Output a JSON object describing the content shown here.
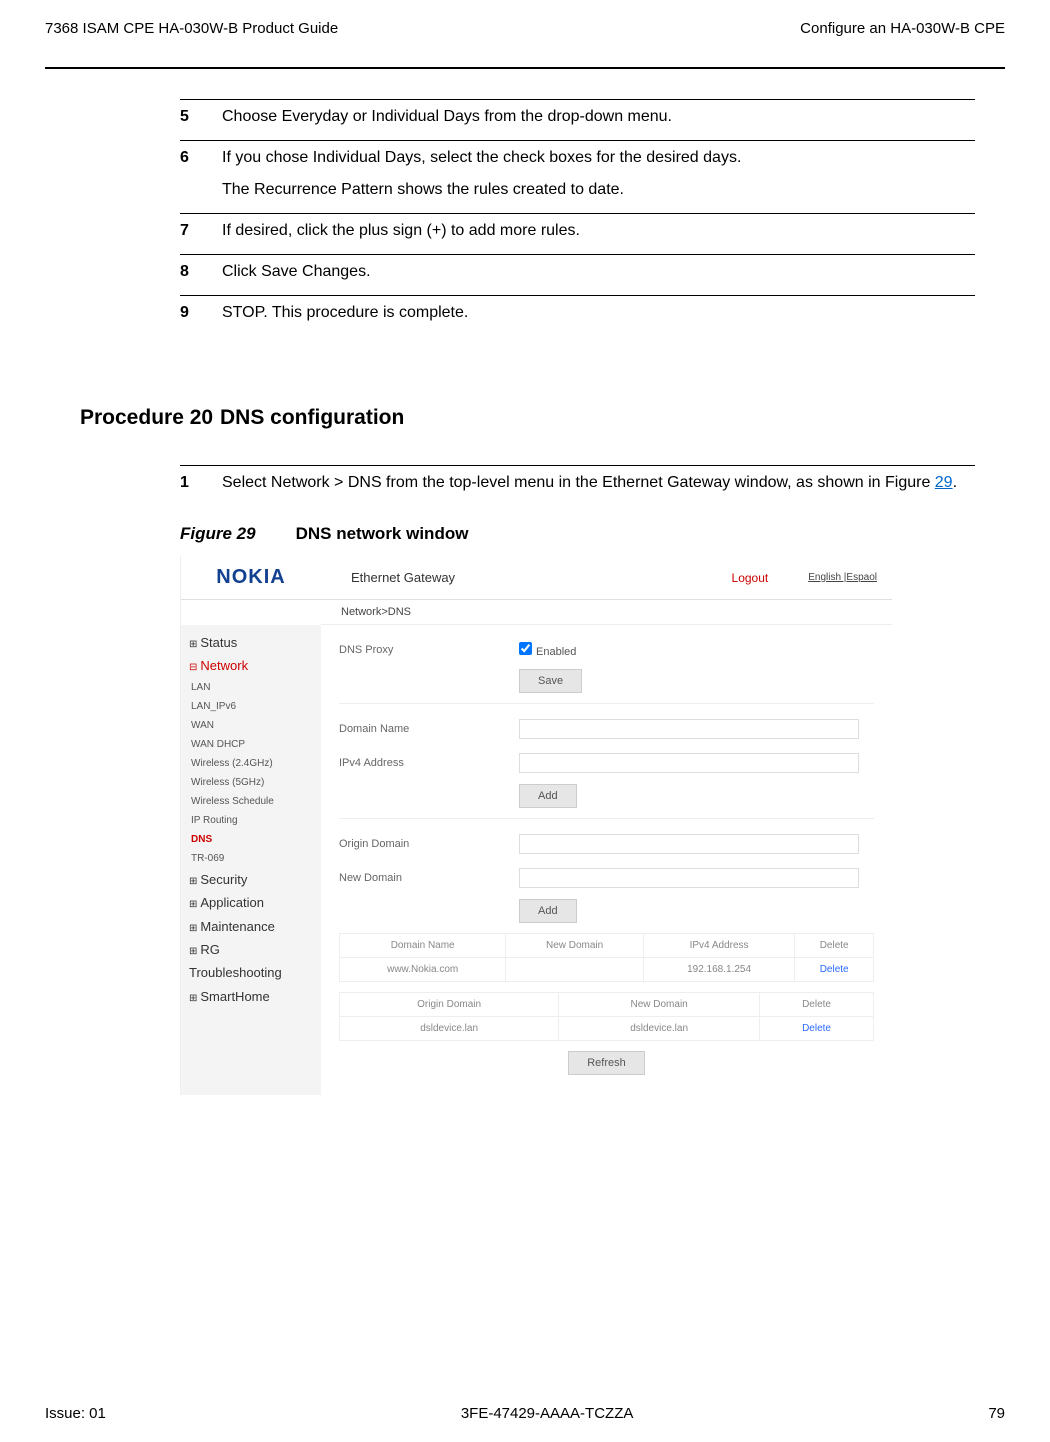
{
  "header": {
    "left": "7368 ISAM CPE HA-030W-B Product Guide",
    "right": "Configure an HA-030W-B CPE"
  },
  "steps_a": [
    {
      "n": "5",
      "t": "Choose Everyday or Individual Days from the drop-down menu."
    },
    {
      "n": "6",
      "t": "If you chose Individual Days, select the check boxes for the desired days.",
      "sub": "The Recurrence Pattern shows the rules created to date."
    },
    {
      "n": "7",
      "t": "If desired, click the plus sign (+) to add more rules."
    },
    {
      "n": "8",
      "t": "Click Save Changes."
    },
    {
      "n": "9",
      "t": "STOP. This procedure is complete."
    }
  ],
  "procedure": {
    "label": "Procedure 20",
    "title": "DNS configuration"
  },
  "step_b": {
    "n": "1",
    "pre": "Select Network > DNS from the top-level menu in the Ethernet Gateway window, as shown in Figure ",
    "link": "29",
    "post": "."
  },
  "figure": {
    "num": "Figure 29",
    "title": "DNS network window"
  },
  "shot": {
    "brand": "NOKIA",
    "gw": "Ethernet Gateway",
    "logout": "Logout",
    "lang1": "English",
    "lang2": "Espaol",
    "crumb": "Network>DNS",
    "side_top": [
      "Status"
    ],
    "side_network": "Network",
    "side_subs": [
      "LAN",
      "LAN_IPv6",
      "WAN",
      "WAN DHCP",
      "Wireless (2.4GHz)",
      "Wireless (5GHz)",
      "Wireless Schedule",
      "IP Routing",
      "DNS",
      "TR-069"
    ],
    "side_bottom": [
      "Security",
      "Application",
      "Maintenance",
      "RG Troubleshooting",
      "SmartHome"
    ],
    "proxy_label": "DNS Proxy",
    "proxy_enabled": "Enabled",
    "save_btn": "Save",
    "domain_name_lbl": "Domain Name",
    "ipv4_addr_lbl": "IPv4 Address",
    "add_btn": "Add",
    "origin_lbl": "Origin Domain",
    "newdom_lbl": "New Domain",
    "table1": {
      "headers": [
        "Domain Name",
        "New Domain",
        "IPv4 Address",
        "Delete"
      ],
      "row": [
        "www.Nokia.com",
        "",
        "192.168.1.254",
        "Delete"
      ]
    },
    "table2": {
      "headers": [
        "Origin Domain",
        "New Domain",
        "Delete"
      ],
      "row": [
        "dsldevice.lan",
        "dsldevice.lan",
        "Delete"
      ]
    },
    "refresh_btn": "Refresh"
  },
  "footer": {
    "left": "Issue: 01",
    "center": "3FE-47429-AAAA-TCZZA",
    "right": "79"
  }
}
